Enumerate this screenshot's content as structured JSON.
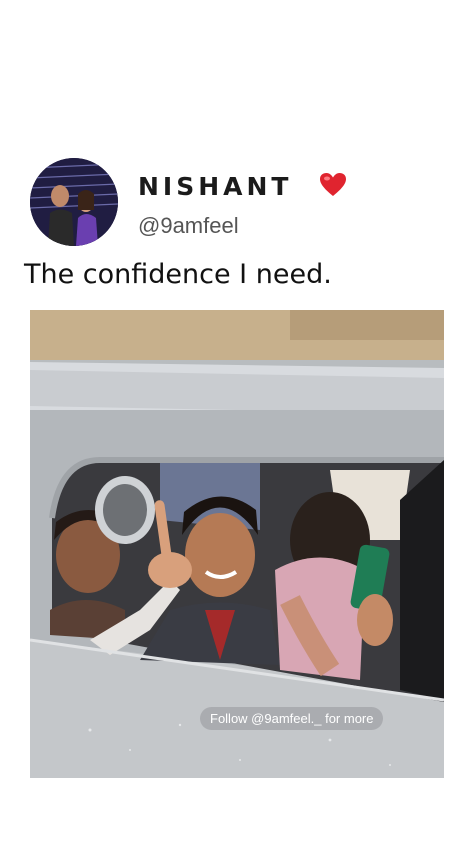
{
  "post": {
    "display_name": "NISHANT",
    "handle": "@9amfeel",
    "caption": "The confidence I need.",
    "heart_color": "#e0242f"
  },
  "video": {
    "watermark": "Follow @9amfeel._ for more"
  }
}
